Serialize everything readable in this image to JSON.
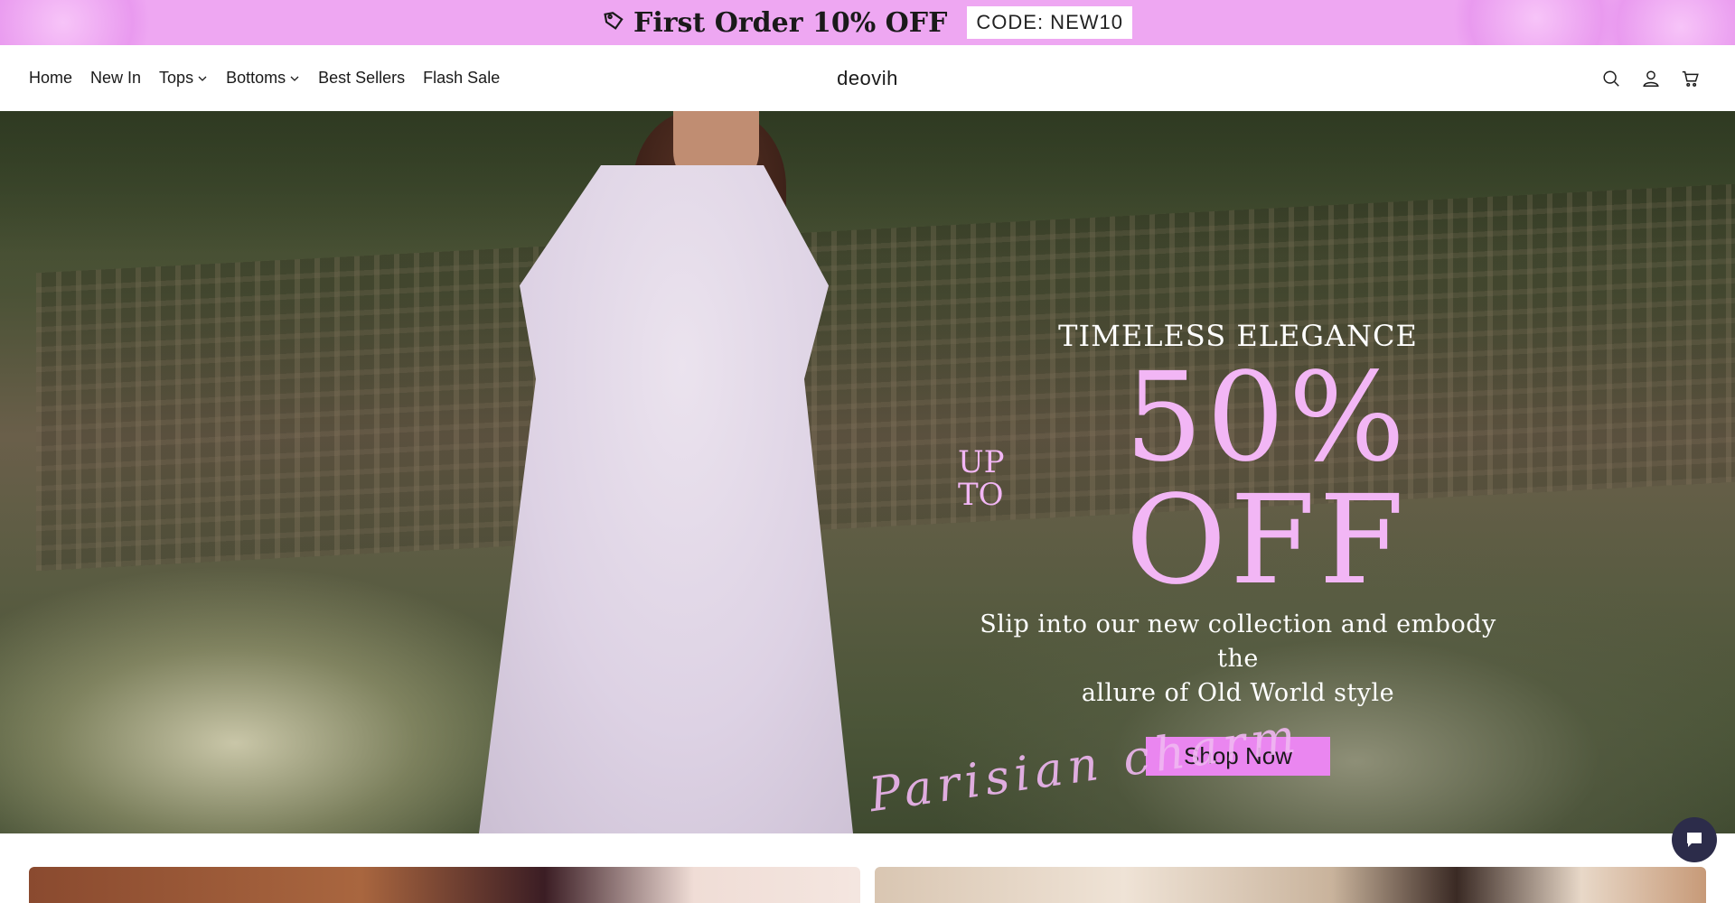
{
  "announcement": {
    "text": "First Order 10% OFF",
    "code": "CODE: NEW10",
    "icon": "tag-icon"
  },
  "header": {
    "nav": [
      {
        "label": "Home"
      },
      {
        "label": "New In"
      },
      {
        "label": "Tops",
        "has_dropdown": true
      },
      {
        "label": "Bottoms",
        "has_dropdown": true
      },
      {
        "label": "Best Sellers"
      },
      {
        "label": "Flash Sale"
      }
    ],
    "logo": "deovih",
    "icons": [
      "search-icon",
      "account-icon",
      "cart-icon"
    ]
  },
  "hero": {
    "kicker": "TIMELESS ELEGANCE",
    "up": "UP",
    "to": "TO",
    "discount": "50% OFF",
    "subtitle_line1": "Slip into our new collection and embody the",
    "subtitle_line2": "allure of Old World style",
    "cta": "Shop Now",
    "script_text": "Parisian charm"
  },
  "colors": {
    "announcement_bg": "#eea7f2",
    "accent_pink": "#ea86f0",
    "discount_pink": "#f2b6f5"
  },
  "chat": {
    "icon": "chat-icon"
  }
}
